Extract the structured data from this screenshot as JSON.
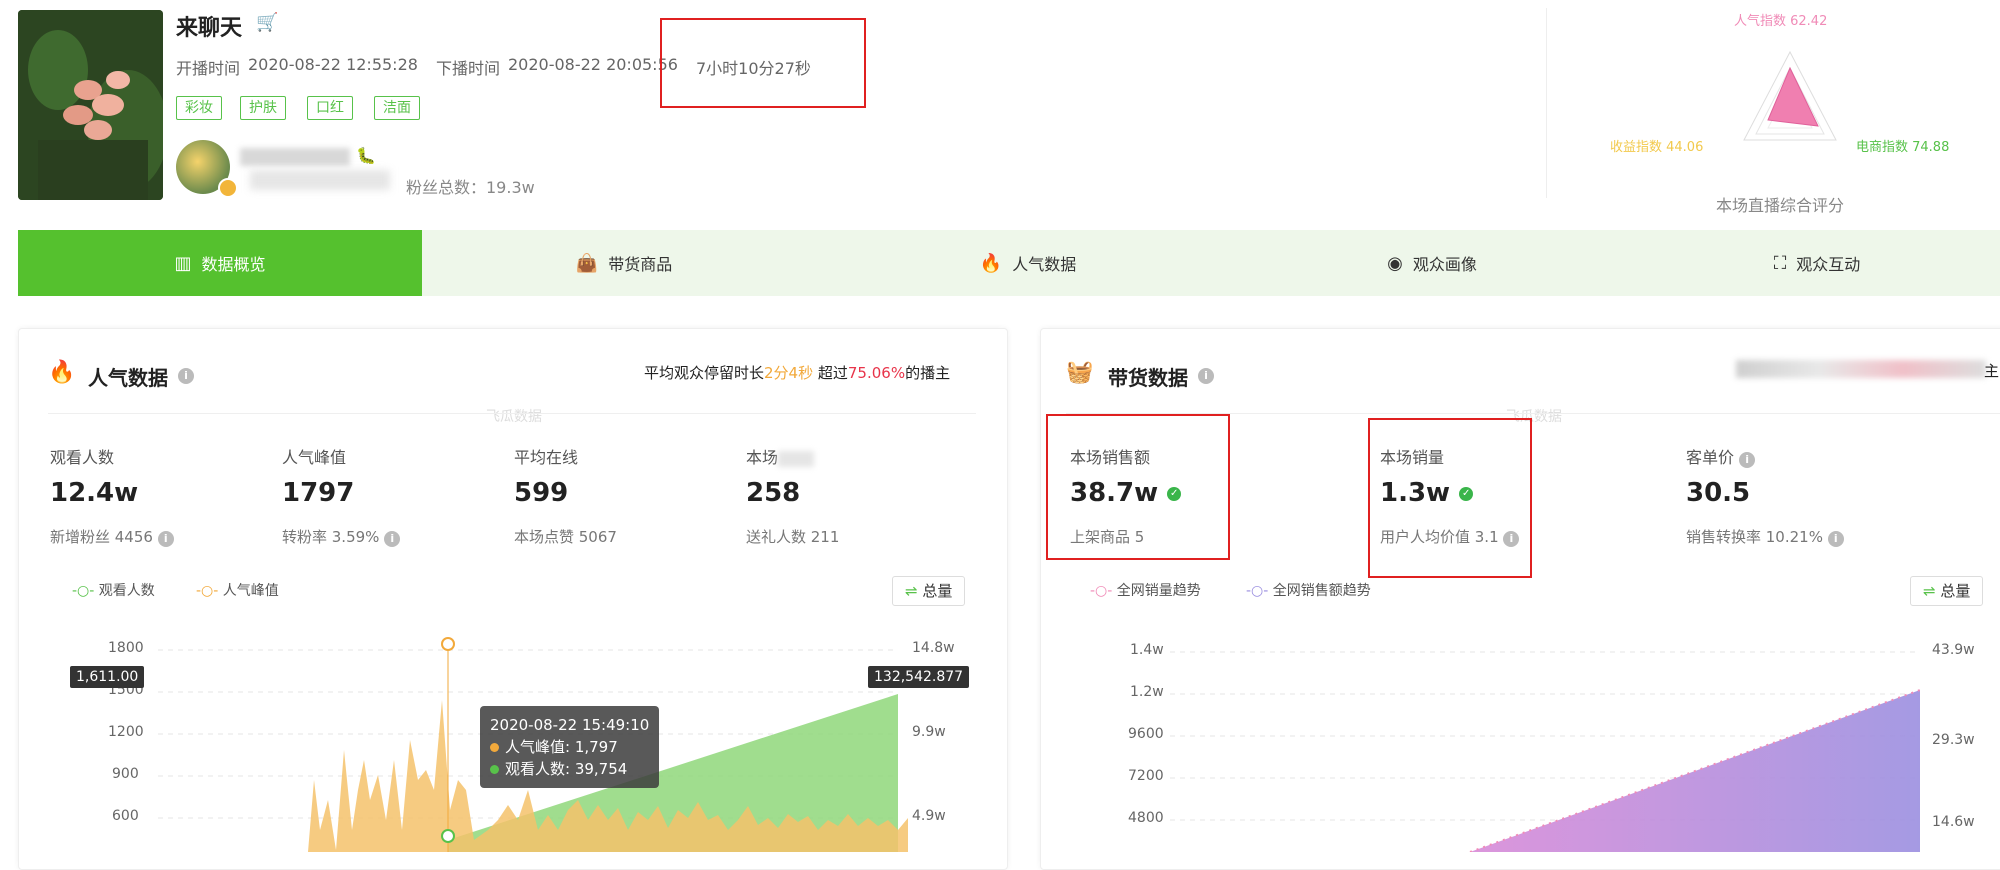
{
  "header": {
    "title": "来聊天",
    "start_label": "开播时间",
    "start_time": "2020-08-22 12:55:28",
    "end_label": "下播时间",
    "end_time": "2020-08-22 20:05:56",
    "duration": "7小时10分27秒",
    "tags": [
      "彩妆",
      "护肤",
      "口红",
      "洁面"
    ],
    "fans_label": "粉丝总数：19.3w"
  },
  "radar": {
    "popularity": "人气指数 62.42",
    "income": "收益指数 44.06",
    "ecommerce": "电商指数 74.88",
    "caption": "本场直播综合评分"
  },
  "tabs": [
    {
      "label": "数据概览",
      "icon": "bar-chart-icon"
    },
    {
      "label": "带货商品",
      "icon": "bag-icon"
    },
    {
      "label": "人气数据",
      "icon": "flame-icon"
    },
    {
      "label": "观众画像",
      "icon": "portrait-icon"
    },
    {
      "label": "观众互动",
      "icon": "interaction-icon"
    }
  ],
  "left": {
    "title": "人气数据",
    "summary_prefix": "平均观众停留时长",
    "summary_time": "2分4秒",
    "summary_mid": " 超过",
    "summary_pct": "75.06%",
    "summary_suffix": "的播主",
    "watermark": "飞瓜数据",
    "metrics": [
      {
        "label": "观看人数",
        "value": "12.4w",
        "sub": "新增粉丝 4456"
      },
      {
        "label": "人气峰值",
        "value": "1797",
        "sub": "转粉率 3.59%"
      },
      {
        "label": "平均在线",
        "value": "599",
        "sub": "本场点赞 5067"
      },
      {
        "label": "本场",
        "value": "258",
        "sub": "送礼人数 211"
      }
    ],
    "legend": [
      "观看人数",
      "人气峰值"
    ],
    "total_btn": "总量",
    "left_axis": [
      "1800",
      "1500",
      "1200",
      "900",
      "600"
    ],
    "right_axis": [
      "14.8w",
      "9.9w",
      "4.9w"
    ],
    "marker_left": "1,611.00",
    "marker_right": "132,542.877",
    "tooltip": {
      "time": "2020-08-22 15:49:10",
      "line1": "人气峰值: 1,797",
      "line2": "观看人数: 39,754"
    }
  },
  "right": {
    "title": "带货数据",
    "watermark": "飞瓜数据",
    "header_suffix": "主",
    "metrics": [
      {
        "label": "本场销售额",
        "value": "38.7w",
        "sub": "上架商品 5"
      },
      {
        "label": "本场销量",
        "value": "1.3w",
        "sub": "用户人均价值 3.1"
      },
      {
        "label": "客单价",
        "value": "30.5",
        "sub": "销售转换率 10.21%"
      }
    ],
    "legend": [
      "全网销量趋势",
      "全网销售额趋势"
    ],
    "total_btn": "总量",
    "left_axis": [
      "1.4w",
      "1.2w",
      "9600",
      "7200",
      "4800"
    ],
    "right_axis": [
      "43.9w",
      "29.3w",
      "14.6w"
    ]
  },
  "colors": {
    "brand_green": "#55c12e",
    "orange": "#f2a93b",
    "pink": "#f08bb7",
    "purple": "#9b8fe0",
    "red_box": "#e02020"
  }
}
